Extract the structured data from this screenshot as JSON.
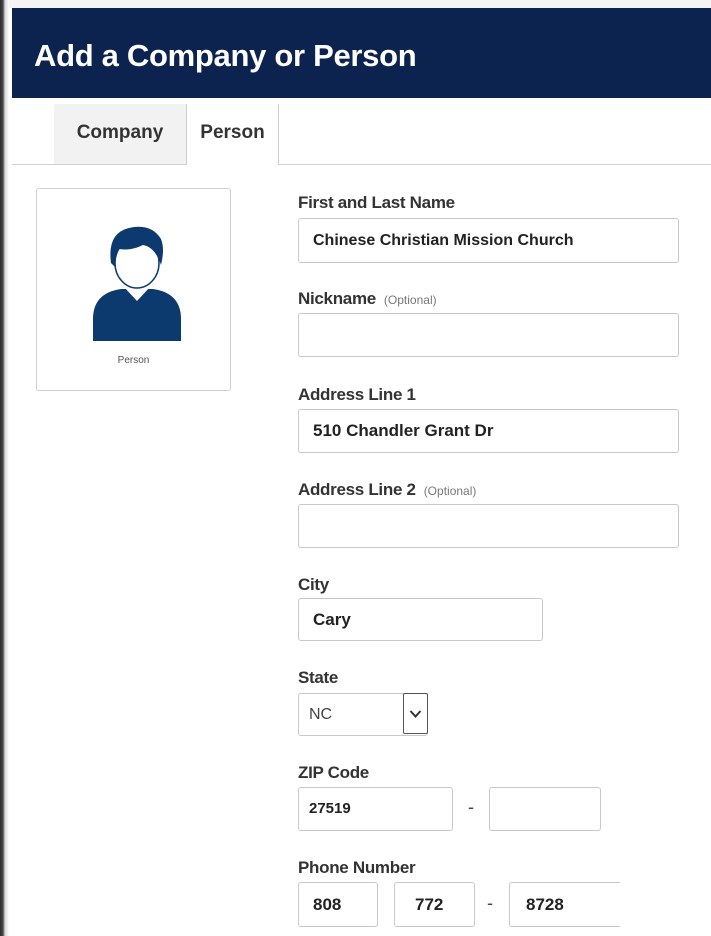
{
  "header": {
    "title": "Add a Company or Person"
  },
  "tabs": [
    {
      "label": "Company",
      "active": false
    },
    {
      "label": "Person",
      "active": true
    }
  ],
  "avatar": {
    "caption": "Person",
    "icon": "person-icon",
    "color": "#0c3a6e"
  },
  "form": {
    "name": {
      "label": "First and Last Name",
      "value": "Chinese Christian Mission Church"
    },
    "nickname": {
      "label": "Nickname",
      "optional": "(Optional)",
      "value": ""
    },
    "address1": {
      "label": "Address Line 1",
      "value": "510 Chandler Grant Dr"
    },
    "address2": {
      "label": "Address Line 2",
      "optional": "(Optional)",
      "value": ""
    },
    "city": {
      "label": "City",
      "value": "Cary"
    },
    "state": {
      "label": "State",
      "value": "NC"
    },
    "zip": {
      "label": "ZIP Code",
      "value": "27519",
      "ext": "",
      "separator": "-"
    },
    "phone": {
      "label": "Phone Number",
      "area": "808",
      "prefix": "772",
      "line": "8728",
      "separator": "-"
    }
  },
  "colors": {
    "header_bg": "#0c2350",
    "header_text": "#ffffff"
  }
}
